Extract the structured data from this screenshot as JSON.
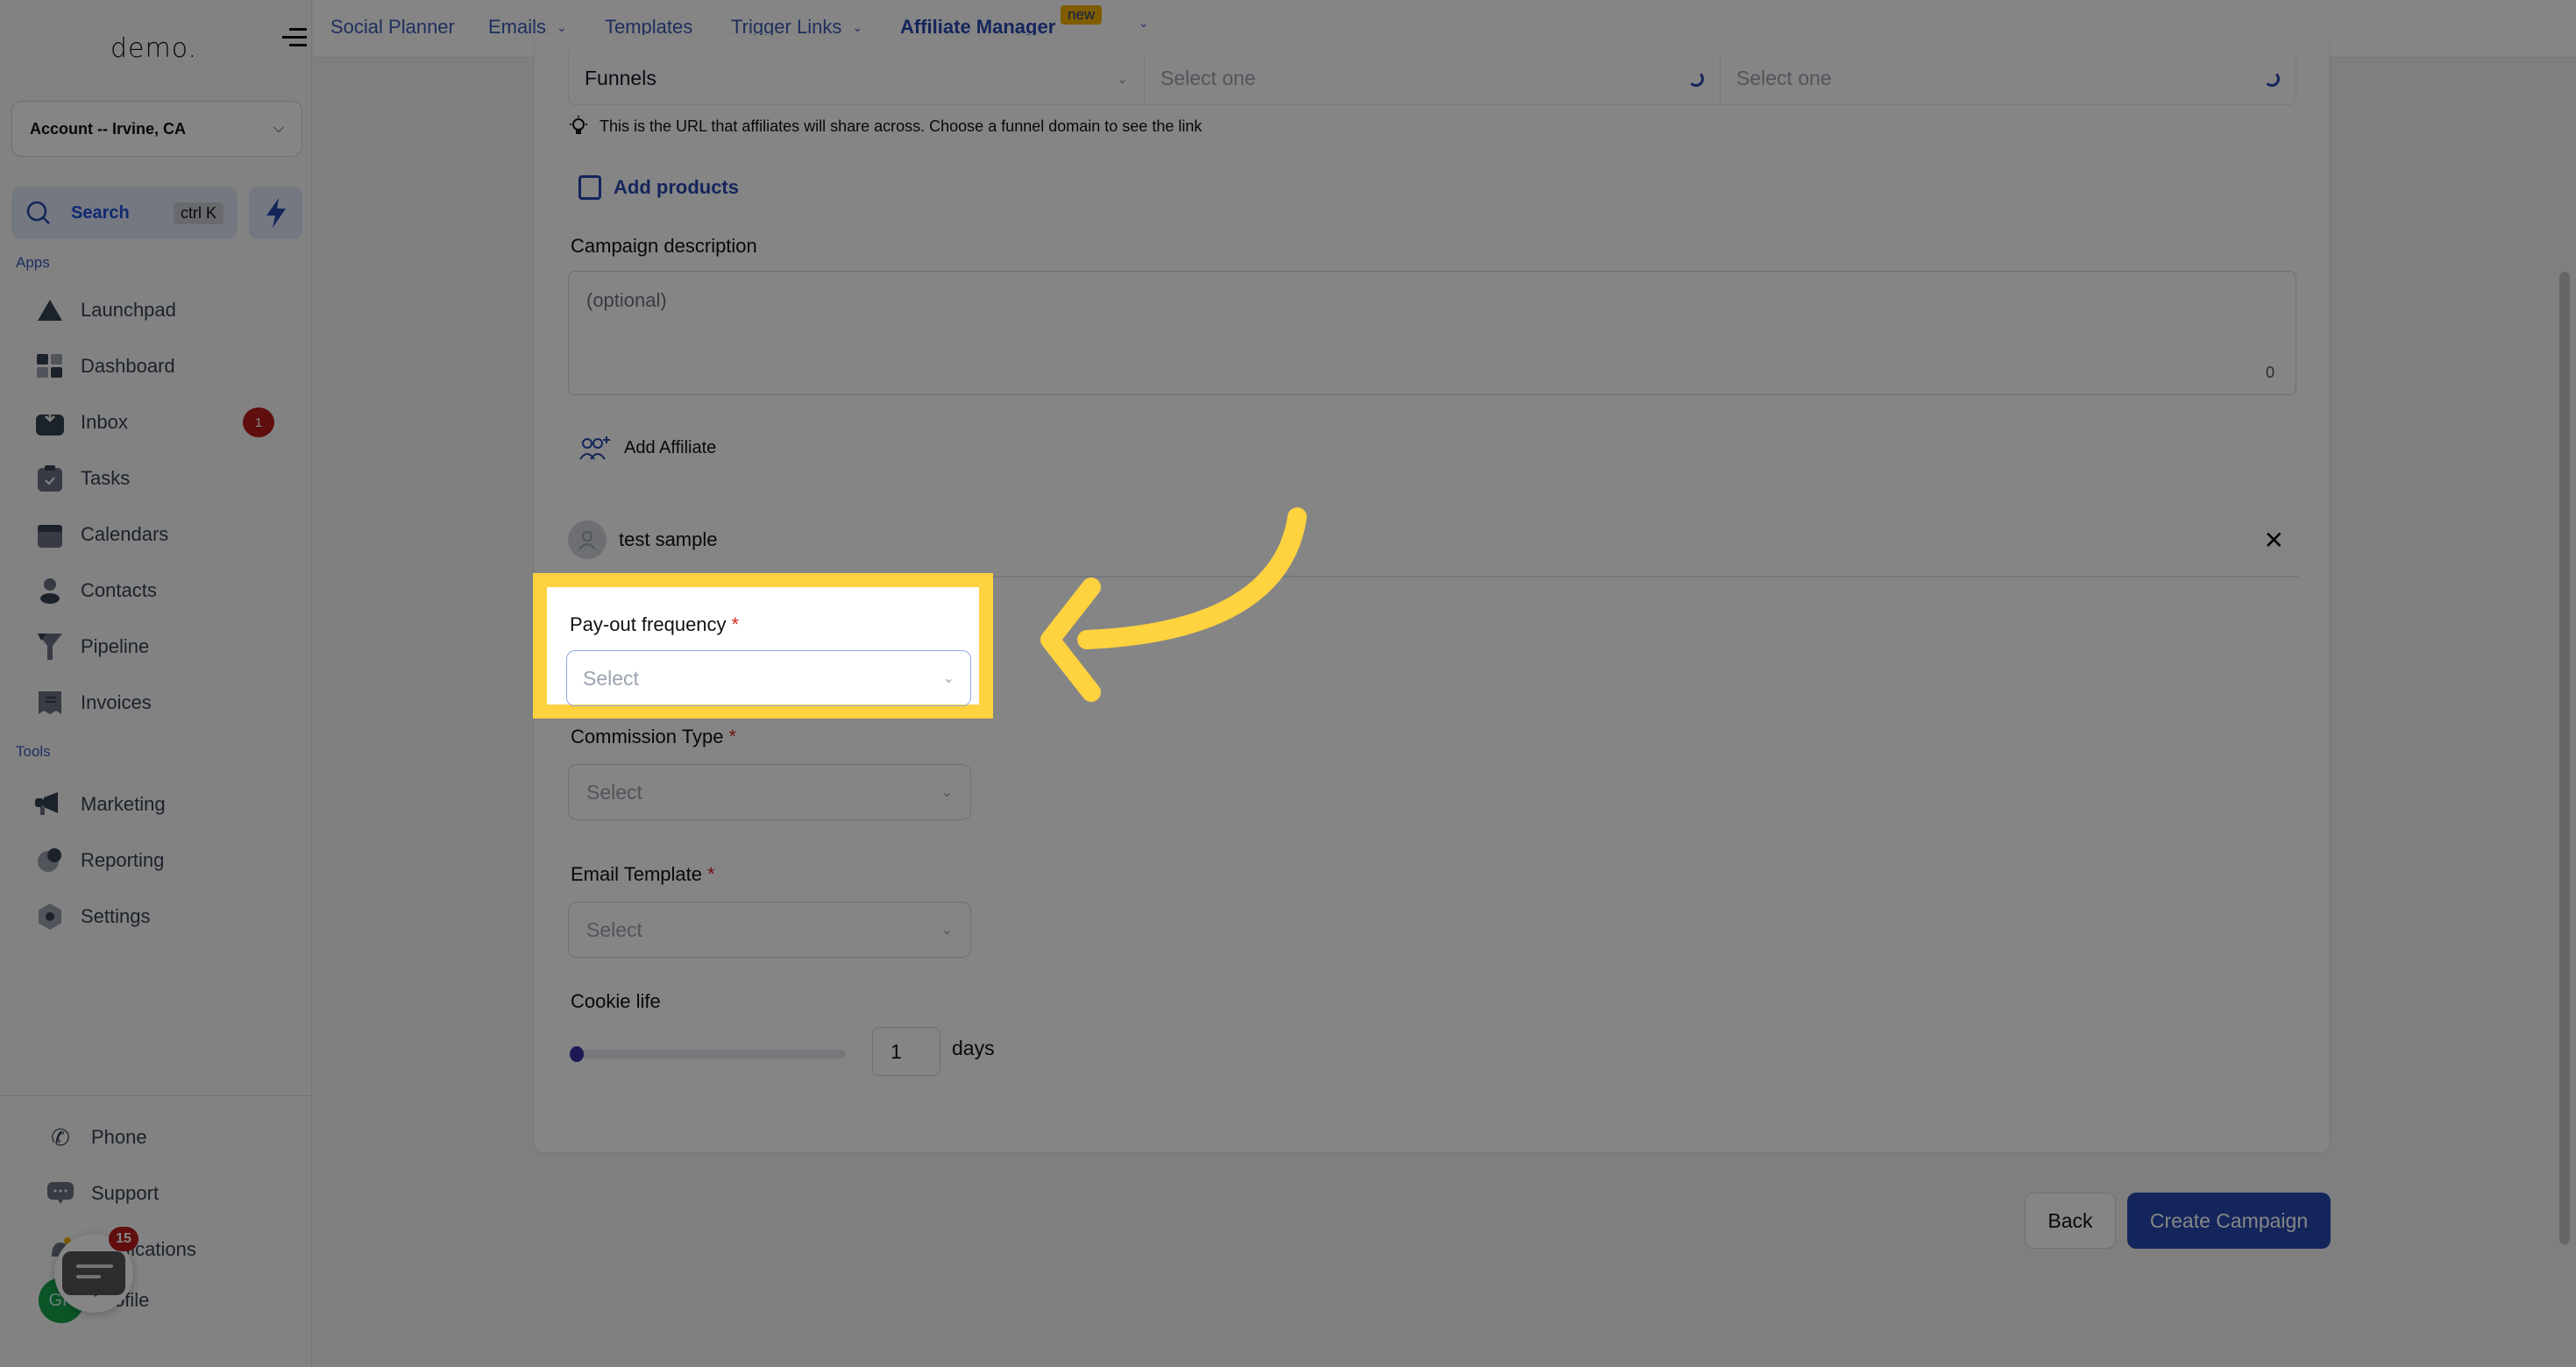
{
  "sidebar": {
    "logo": "demo.",
    "account": "Account -- Irvine, CA",
    "search_label": "Search",
    "search_shortcut": "ctrl K",
    "apps_label": "Apps",
    "tools_label": "Tools",
    "apps": [
      {
        "label": "Launchpad",
        "icon": "launchpad-icon"
      },
      {
        "label": "Dashboard",
        "icon": "dashboard-icon"
      },
      {
        "label": "Inbox",
        "icon": "inbox-icon",
        "badge": "1"
      },
      {
        "label": "Tasks",
        "icon": "tasks-icon"
      },
      {
        "label": "Calendars",
        "icon": "calendar-icon"
      },
      {
        "label": "Contacts",
        "icon": "contacts-icon"
      },
      {
        "label": "Pipeline",
        "icon": "pipeline-icon"
      },
      {
        "label": "Invoices",
        "icon": "invoices-icon"
      }
    ],
    "tools": [
      {
        "label": "Marketing",
        "icon": "megaphone-icon"
      },
      {
        "label": "Reporting",
        "icon": "reporting-icon"
      },
      {
        "label": "Settings",
        "icon": "settings-icon"
      }
    ],
    "bottom": [
      {
        "label": "Phone",
        "icon": "phone-icon"
      },
      {
        "label": "Support",
        "icon": "support-icon"
      },
      {
        "label": "Notifications",
        "icon": "bell-icon"
      },
      {
        "label": "Profile",
        "icon": "avatar"
      }
    ],
    "avatar_initials": "GP",
    "chat_badge": "15"
  },
  "topnav": {
    "tabs": [
      {
        "label": "Social Planner",
        "dropdown": false
      },
      {
        "label": "Emails",
        "dropdown": true
      },
      {
        "label": "Templates",
        "dropdown": false
      },
      {
        "label": "Trigger Links",
        "dropdown": true
      },
      {
        "label": "Affiliate Manager",
        "dropdown": false,
        "active": true,
        "badge": "new"
      }
    ],
    "more_chevron": "⌄"
  },
  "form": {
    "url_row": {
      "type_value": "Funnels",
      "domain_placeholder": "Select one",
      "page_placeholder": "Select one"
    },
    "hint": "This is the URL that affiliates will share across. Choose a funnel domain to see the link",
    "add_products": "Add products",
    "campaign_description": {
      "label": "Campaign description",
      "placeholder": "(optional)",
      "char_count": "0"
    },
    "add_affiliate": "Add Affiliate",
    "affiliates": [
      {
        "name": "test sample"
      }
    ],
    "payout_frequency": {
      "label": "Pay-out frequency",
      "required": "*",
      "placeholder": "Select"
    },
    "commission_type": {
      "label": "Commission Type",
      "required": "*",
      "placeholder": "Select"
    },
    "email_template": {
      "label": "Email Template",
      "required": "*",
      "placeholder": "Select"
    },
    "cookie_life": {
      "label": "Cookie life",
      "value": "1",
      "unit": "days",
      "slider_fraction": 0.0
    }
  },
  "actions": {
    "back": "Back",
    "create": "Create Campaign"
  },
  "colors": {
    "accent": "#2748b0",
    "highlight": "#ffd23f",
    "badge_red": "#b91c1c",
    "new_badge": "#f5b100"
  }
}
